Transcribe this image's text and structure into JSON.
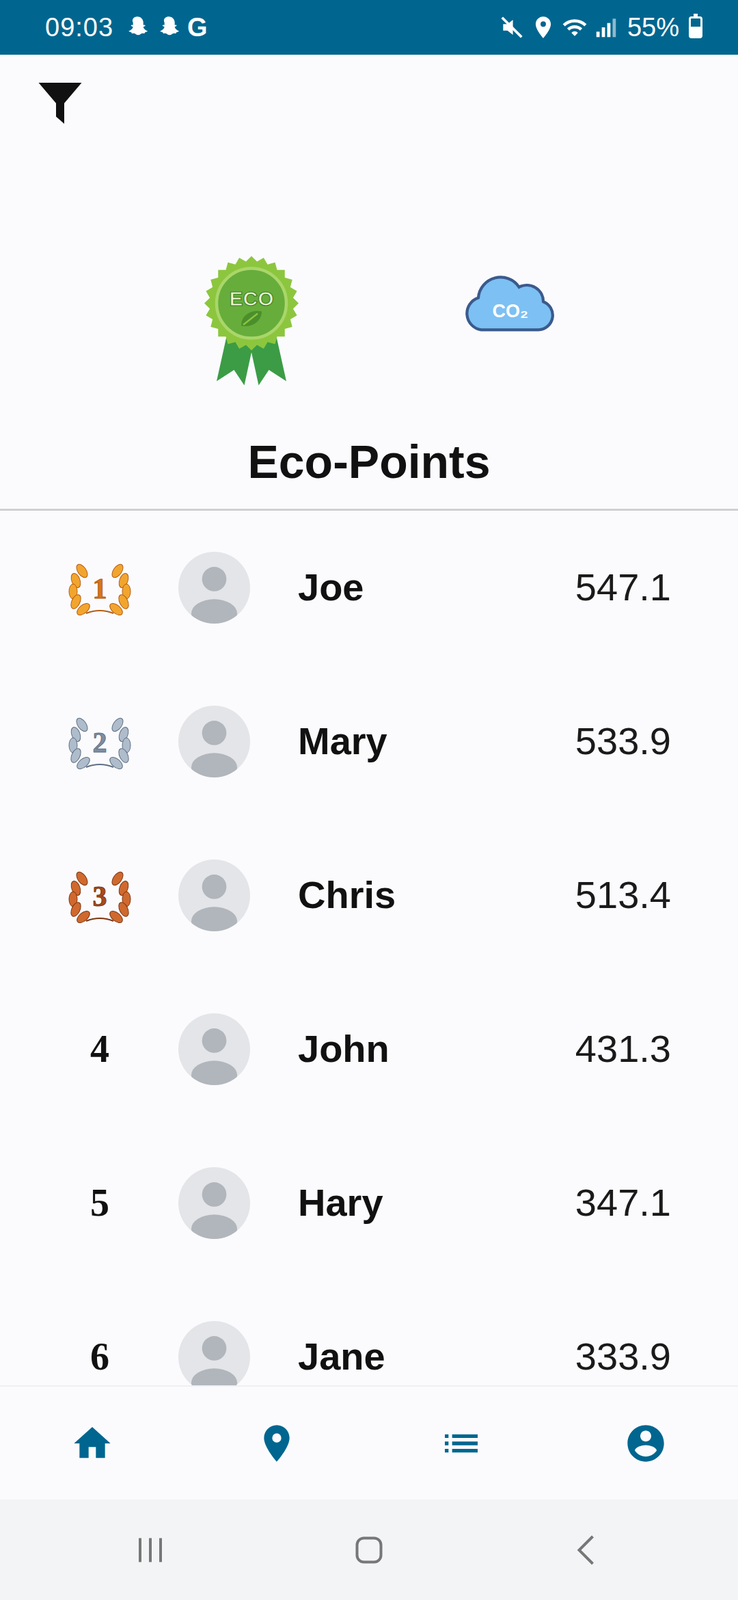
{
  "status_bar": {
    "time": "09:03",
    "carrier": "G",
    "battery": "55%",
    "battery_level": 0.55
  },
  "header": {
    "badge_text": "ECO",
    "cloud_text": "CO₂",
    "title": "Eco-Points"
  },
  "leaderboard": [
    {
      "rank": "1",
      "name": "Joe",
      "points": "547.1",
      "kind": "gold"
    },
    {
      "rank": "2",
      "name": "Mary",
      "points": "533.9",
      "kind": "silver"
    },
    {
      "rank": "3",
      "name": "Chris",
      "points": "513.4",
      "kind": "bronze"
    },
    {
      "rank": "4",
      "name": "John",
      "points": "431.3",
      "kind": "plain"
    },
    {
      "rank": "5",
      "name": "Hary",
      "points": "347.1",
      "kind": "plain"
    },
    {
      "rank": "6",
      "name": "Jane",
      "points": "333.9",
      "kind": "plain"
    }
  ]
}
